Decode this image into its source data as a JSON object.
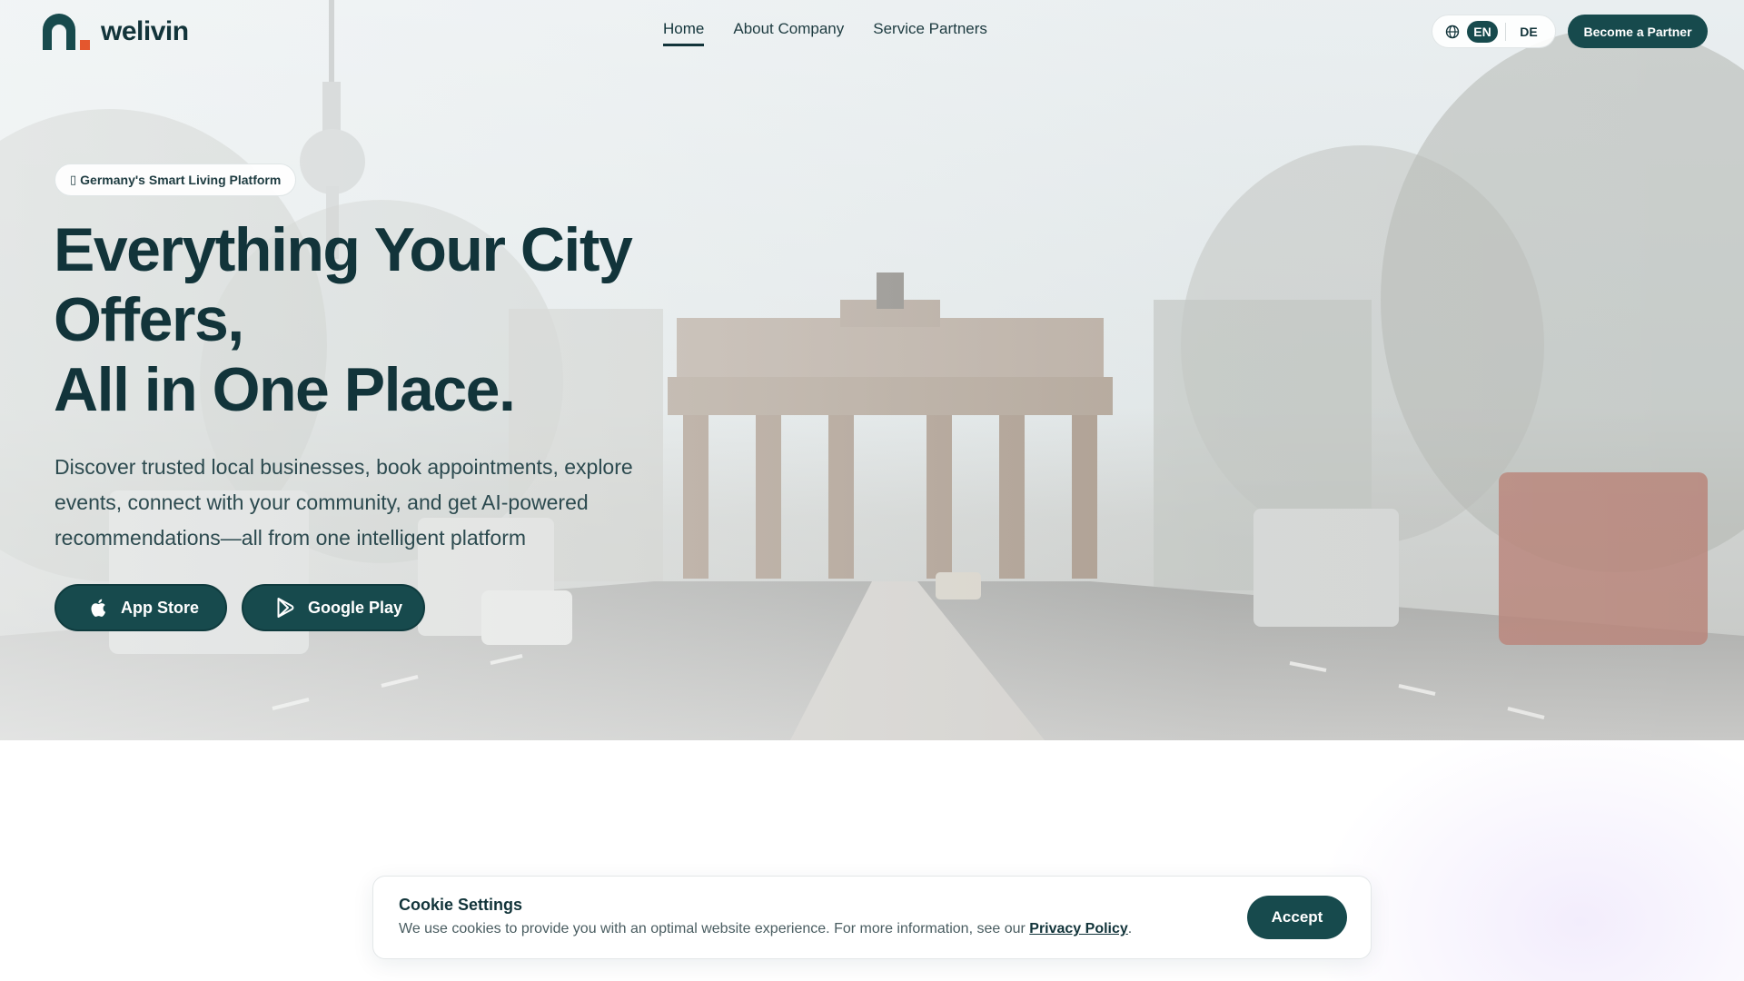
{
  "brand": {
    "name": "welivin",
    "logo_icon": "welivin-logo-mark",
    "accent_color": "#174a4d",
    "dot_color": "#e4572e"
  },
  "nav": {
    "items": [
      {
        "label": "Home",
        "active": true
      },
      {
        "label": "About Company",
        "active": false
      },
      {
        "label": "Service Partners",
        "active": false
      }
    ]
  },
  "language": {
    "icon": "globe-icon",
    "options": [
      "EN",
      "DE"
    ],
    "selected": "EN"
  },
  "header_cta": {
    "label": "Become a Partner"
  },
  "hero": {
    "badge": "Germany's Smart Living Platform",
    "badge_glyph": "▯",
    "headline_lines": [
      "Everything Your City",
      "Offers,",
      "All in One Place."
    ],
    "subcopy": "Discover trusted local businesses, book appointments, explore events, connect with your community, and get AI-powered recommendations—all from one intelligent platform",
    "buttons": [
      {
        "label": "App Store",
        "icon": "apple-icon"
      },
      {
        "label": "Google Play",
        "icon": "google-play-icon"
      }
    ],
    "background": "Brandenburg Gate street scene photo"
  },
  "cookie": {
    "title": "Cookie Settings",
    "text": "We use cookies to provide you with an optimal website experience. For more information, see our ",
    "link_label": "Privacy Policy",
    "text_end": ".",
    "accept_label": "Accept"
  }
}
